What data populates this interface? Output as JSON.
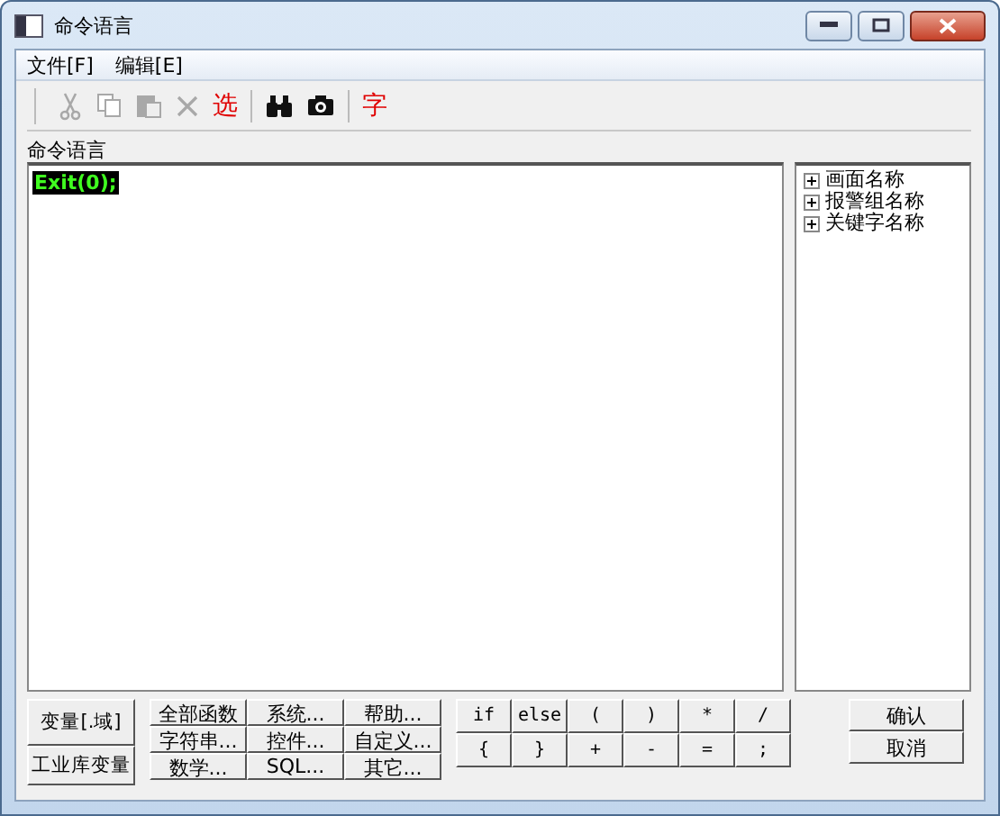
{
  "window": {
    "title": "命令语言"
  },
  "menu": [
    {
      "label": "文件[F]"
    },
    {
      "label": "编辑[E]"
    }
  ],
  "toolbar": [
    {
      "kind": "cut",
      "disabled": true
    },
    {
      "kind": "copy",
      "disabled": true
    },
    {
      "kind": "paste",
      "disabled": true
    },
    {
      "kind": "delete",
      "disabled": true
    },
    {
      "kind": "text",
      "label": "选",
      "disabled": false
    },
    {
      "kind": "sep"
    },
    {
      "kind": "binoculars",
      "disabled": false
    },
    {
      "kind": "camera",
      "disabled": false
    },
    {
      "kind": "sep"
    },
    {
      "kind": "text",
      "label": "字",
      "disabled": false
    }
  ],
  "editor": {
    "label": "命令语言",
    "code": "Exit(0);"
  },
  "tree": [
    {
      "label": "画面名称",
      "expanded": false
    },
    {
      "label": "报警组名称",
      "expanded": false
    },
    {
      "label": "关键字名称",
      "expanded": false
    }
  ],
  "variable_buttons": [
    "变量[.域]",
    "工业库变量"
  ],
  "function_buttons": [
    "全部函数",
    "系统...",
    "帮助...",
    "字符串...",
    "控件...",
    "自定义...",
    "数学...",
    "SQL...",
    "其它..."
  ],
  "operator_buttons": [
    "if",
    "else",
    "(",
    ")",
    "*",
    "/",
    "{",
    "}",
    "+",
    "-",
    "=",
    ";"
  ],
  "dialog_buttons": [
    "确认",
    "取消"
  ]
}
